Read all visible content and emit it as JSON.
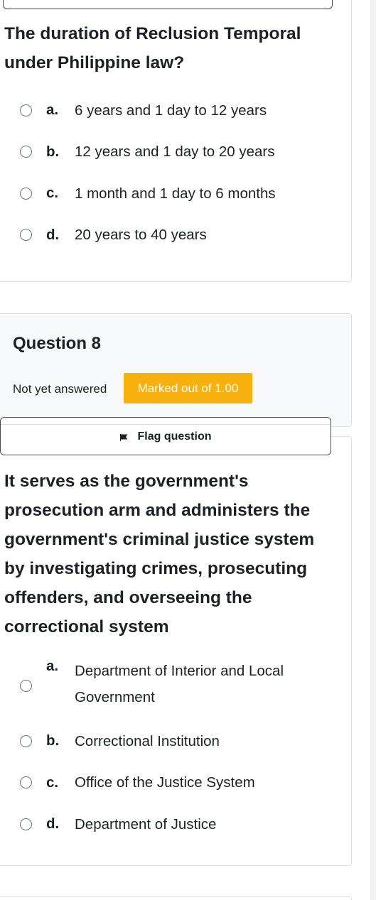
{
  "question7": {
    "text": "The duration of Reclusion Temporal under Philippine law?",
    "answers": [
      {
        "num": "a.",
        "text": "6 years and 1 day to 12 years"
      },
      {
        "num": "b.",
        "text": "12 years and 1 day to 20 years"
      },
      {
        "num": "c.",
        "text": "1 month and 1 day to 6 months"
      },
      {
        "num": "d.",
        "text": "20 years to 40 years"
      }
    ]
  },
  "question8": {
    "title": "Question 8",
    "state": "Not yet answered",
    "mark": "Marked out of 1.00",
    "flag_label": "Flag question",
    "text": "It serves as the government's prosecution arm and administers the government's criminal justice system by investigating crimes, prosecuting offenders, and overseeing the correctional system",
    "answers": [
      {
        "num": "a.",
        "text": "Department of Interior and Local Government"
      },
      {
        "num": "b.",
        "text": "Correctional Institution"
      },
      {
        "num": "c.",
        "text": "Office of the Justice System"
      },
      {
        "num": "d.",
        "text": "Department of Justice"
      }
    ]
  },
  "colors": {
    "badge": "#f8b00f",
    "text": "#1d2125",
    "border": "#dee2e6"
  },
  "icons": {
    "flag": "flag-icon",
    "radio": "radio-circle"
  }
}
